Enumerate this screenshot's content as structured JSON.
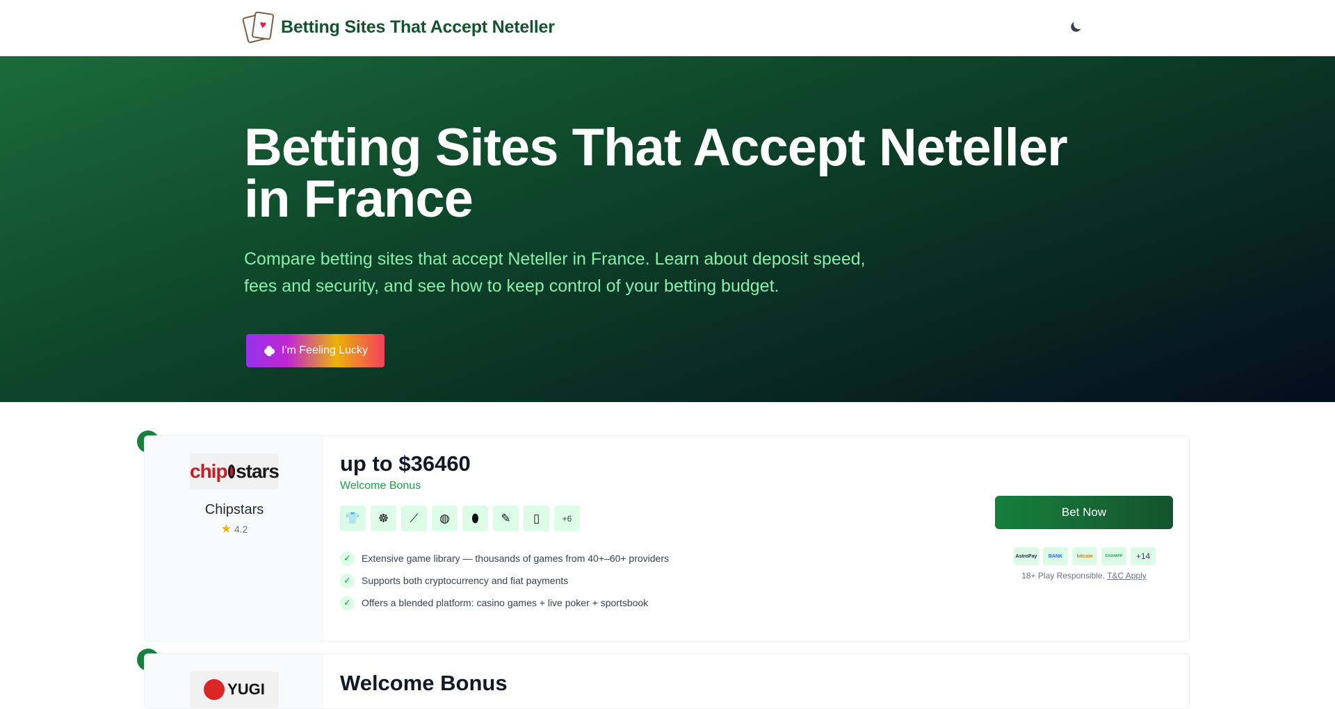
{
  "header": {
    "site_title": "Betting Sites That Accept Neteller",
    "logo_icon": "playing-cards-icon",
    "theme_icon": "moon-icon"
  },
  "hero": {
    "title": "Betting Sites That Accept Neteller in France",
    "subtitle": "Compare betting sites that accept Neteller in France. Learn about deposit speed, fees and security, and see how to keep control of your betting budget.",
    "lucky_button": "I'm Feeling Lucky"
  },
  "listings": [
    {
      "name": "Chipstars",
      "logo_text_a": "chip",
      "logo_text_b": "stars",
      "rating": "4.2",
      "bonus_amount": "up to $36460",
      "bonus_label": "Welcome Bonus",
      "game_icons": [
        "jersey-icon",
        "steering-wheel-icon",
        "cricket-bat-icon",
        "basketball-icon",
        "rugby-ball-icon",
        "badminton-icon",
        "mobile-game-icon"
      ],
      "game_more": "+6",
      "features": [
        "Extensive game library — thousands of games from 40+–60+ providers",
        "Supports both cryptocurrency and fiat payments",
        "Offers a blended platform: casino games + live poker + sportsbook"
      ],
      "bet_button": "Bet Now",
      "payments": [
        "AstroPay",
        "BANK",
        "bitcoin",
        "CASHAPP"
      ],
      "payments_more": "+14",
      "disclaimer_prefix": "18+ Play Responsible.",
      "disclaimer_link": "T&C Apply"
    },
    {
      "name": "Yugi",
      "logo_text": "YUGI",
      "bonus_amount": "Welcome Bonus"
    }
  ],
  "colors": {
    "brand_green": "#14532d",
    "accent_green": "#16a34a",
    "hero_dark": "#040d1c"
  }
}
